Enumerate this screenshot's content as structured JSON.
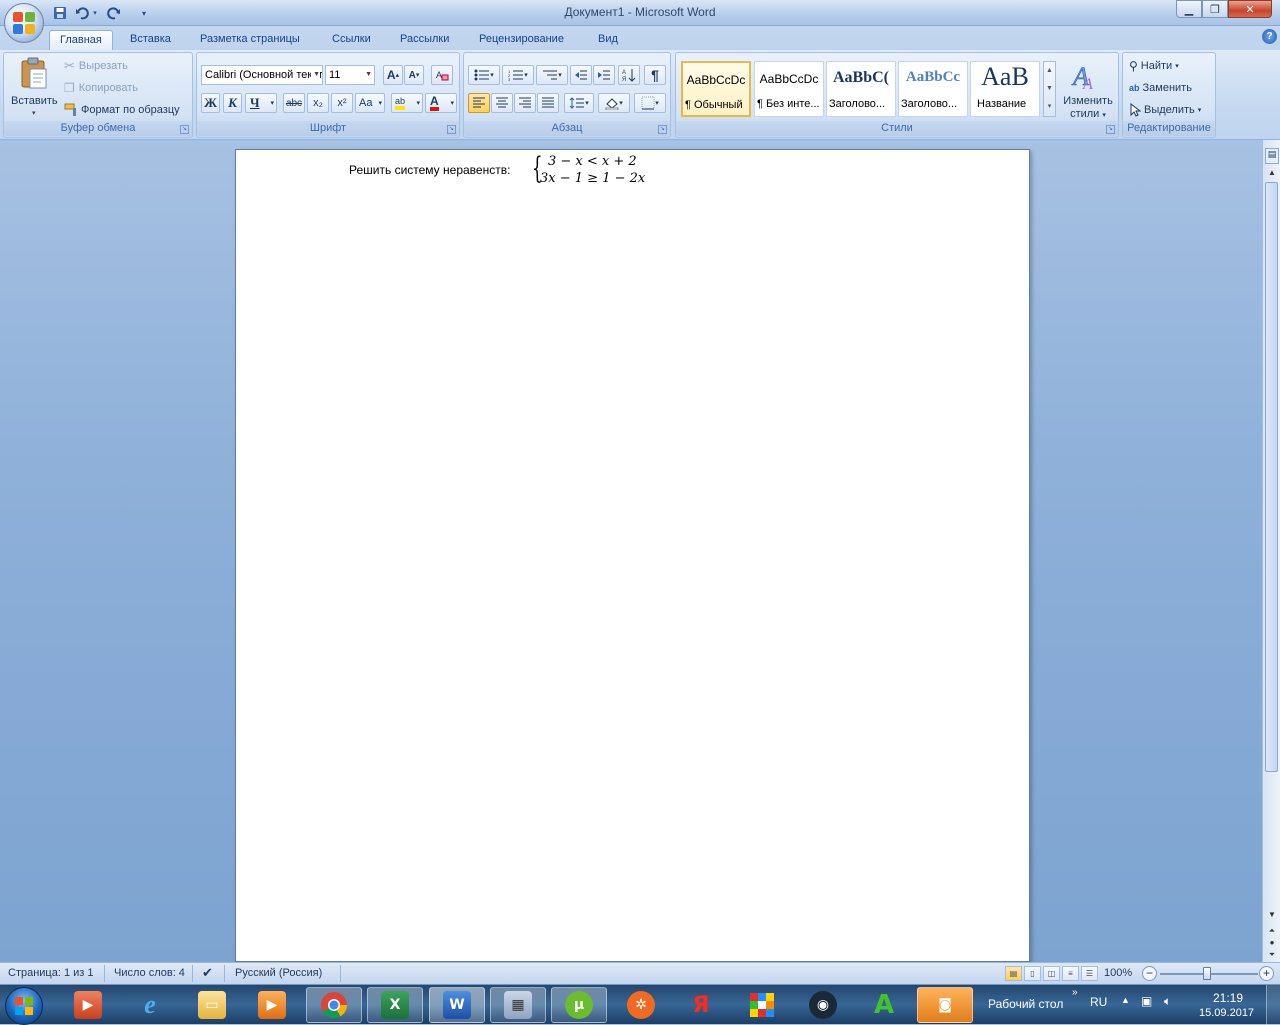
{
  "window": {
    "title": "Документ1 - Microsoft Word",
    "minimize_glyph": "▁",
    "restore_glyph": "❐",
    "close_glyph": "✕",
    "help_glyph": "?"
  },
  "qat": {
    "save_icon": "save-icon",
    "undo_icon": "undo-icon",
    "redo_icon": "redo-icon",
    "customize": "▾"
  },
  "tabs": [
    "Главная",
    "Вставка",
    "Разметка страницы",
    "Ссылки",
    "Рассылки",
    "Рецензирование",
    "Вид"
  ],
  "active_tab": "Главная",
  "clipboard": {
    "label": "Буфер обмена",
    "paste": "Вставить",
    "cut": "Вырезать",
    "copy": "Копировать",
    "format_painter": "Формат по образцу"
  },
  "font": {
    "label": "Шрифт",
    "font_name": "Calibri (Основной текст)",
    "font_size": "11",
    "grow": "A",
    "shrink": "A",
    "bold": "Ж",
    "italic": "К",
    "underline": "Ч",
    "strike": "abc",
    "subscript": "x₂",
    "superscript": "x²",
    "change_case": "Aa",
    "highlight": "ab",
    "font_color": "A"
  },
  "paragraph": {
    "label": "Абзац",
    "pilcrow": "¶"
  },
  "styles": {
    "label": "Стили",
    "items": [
      {
        "preview": "AaBbCcDc",
        "name": "¶ Обычный"
      },
      {
        "preview": "AaBbCcDc",
        "name": "¶ Без инте..."
      },
      {
        "preview": "AaBbC(",
        "name": "Заголово..."
      },
      {
        "preview": "AaBbCc",
        "name": "Заголово..."
      },
      {
        "preview": "AaB",
        "name": "Название"
      }
    ],
    "change_styles_line1": "Изменить",
    "change_styles_line2": "стили"
  },
  "editing": {
    "label": "Редактирование",
    "find": "Найти",
    "replace": "Заменить",
    "select": "Выделить"
  },
  "document": {
    "prompt": "Решить систему неравенств:",
    "line1": "3 − x < x + 2",
    "line2": "3x − 1 ≥ 1 − 2x"
  },
  "status": {
    "page": "Страница: 1 из 1",
    "words": "Число слов: 4",
    "language": "Русский (Россия)",
    "zoom": "100%",
    "zoom_minus": "−",
    "zoom_plus": "+"
  },
  "taskbar": {
    "desktop_label": "Рабочий стол",
    "lang": "RU",
    "time": "21:19",
    "date": "15.09.2017",
    "apps": [
      "media-center-icon",
      "internet-explorer-icon",
      "file-explorer-icon",
      "media-player-icon",
      "chrome-icon",
      "excel-icon",
      "word-icon",
      "calculator-icon",
      "utorrent-icon",
      "media-guide-icon",
      "yandex-browser-icon",
      "rubik-cube-icon",
      "steam-icon",
      "green-a-app-icon",
      "screenshot-tool-icon"
    ],
    "yandex_letter": "Я",
    "a_letter": "A",
    "word_letter": "W",
    "excel_letter": "X"
  }
}
